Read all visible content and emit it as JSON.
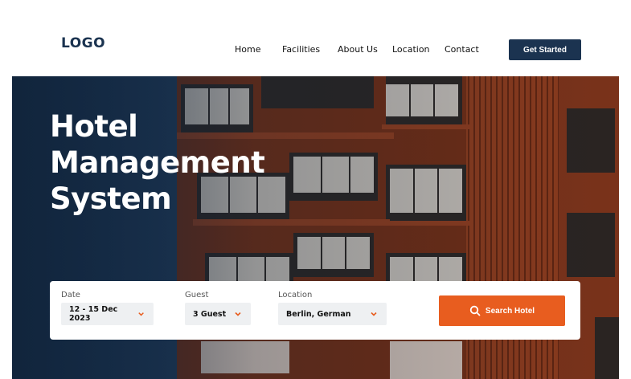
{
  "header": {
    "logo": "LOGO",
    "nav": [
      "Home",
      "Facilities",
      "About Us",
      "Location",
      "Contact"
    ],
    "cta_label": "Get Started"
  },
  "hero": {
    "title_lines": [
      "Hotel",
      "Management",
      "System"
    ]
  },
  "search": {
    "date_label": "Date",
    "date_value": "12 - 15 Dec 2023",
    "guest_label": "Guest",
    "guest_value": "3 Guest",
    "location_label": "Location",
    "location_value": "Berlin, German",
    "button_label": "Search Hotel"
  },
  "colors": {
    "brand": "#1b3350",
    "accent": "#e85d1f"
  }
}
